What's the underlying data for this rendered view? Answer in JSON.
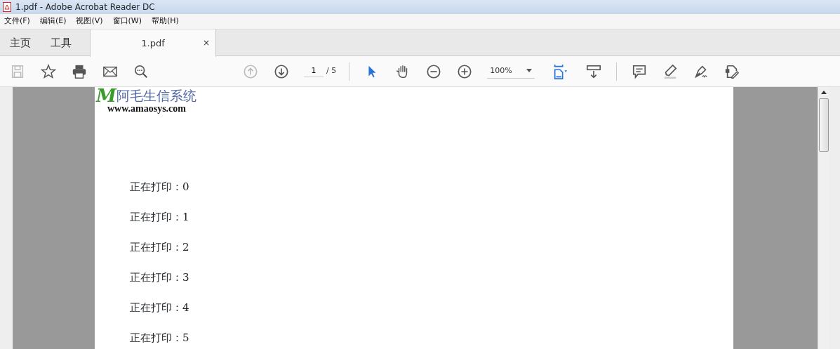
{
  "window": {
    "title": "1.pdf - Adobe Acrobat Reader DC"
  },
  "menu": [
    "文件(F)",
    "编辑(E)",
    "视图(V)",
    "窗口(W)",
    "帮助(H)"
  ],
  "tabs": [
    {
      "label": "主页",
      "selected": false
    },
    {
      "label": "工具",
      "selected": false
    },
    {
      "label": "1.pdf",
      "selected": true,
      "close": "×"
    }
  ],
  "toolbar_left": [
    {
      "kind": "save",
      "disabled": true
    },
    {
      "kind": "star",
      "disabled": false
    },
    {
      "kind": "print",
      "disabled": false
    },
    {
      "kind": "mail",
      "disabled": false
    },
    {
      "kind": "search",
      "disabled": false
    }
  ],
  "nav": [
    {
      "kind": "prev",
      "disabled": true
    },
    {
      "kind": "next",
      "disabled": false
    }
  ],
  "page_field": {
    "value": "1",
    "total": "/ 5"
  },
  "tools": [
    {
      "kind": "select",
      "selected": true
    },
    {
      "kind": "hand",
      "selected": false
    },
    {
      "kind": "zoomout",
      "selected": false
    },
    {
      "kind": "zoomin",
      "selected": false
    }
  ],
  "zoom_field": {
    "value": "100%"
  },
  "tools_right": [
    {
      "kind": "fit",
      "selected": true
    },
    {
      "kind": "scroll",
      "selected": false
    },
    {
      "kind": "sep"
    },
    {
      "kind": "comment",
      "selected": false
    },
    {
      "kind": "highlight",
      "selected": false
    },
    {
      "kind": "sign",
      "selected": false
    },
    {
      "kind": "edit",
      "selected": false
    }
  ],
  "document": {
    "logo_mark": "M",
    "logo_text": "阿毛生信系统",
    "logo_url": "www.amaosys.com",
    "lines": [
      "正在打印：0",
      "正在打印：1",
      "正在打印：2",
      "正在打印：3",
      "正在打印：4",
      "正在打印：5"
    ]
  }
}
